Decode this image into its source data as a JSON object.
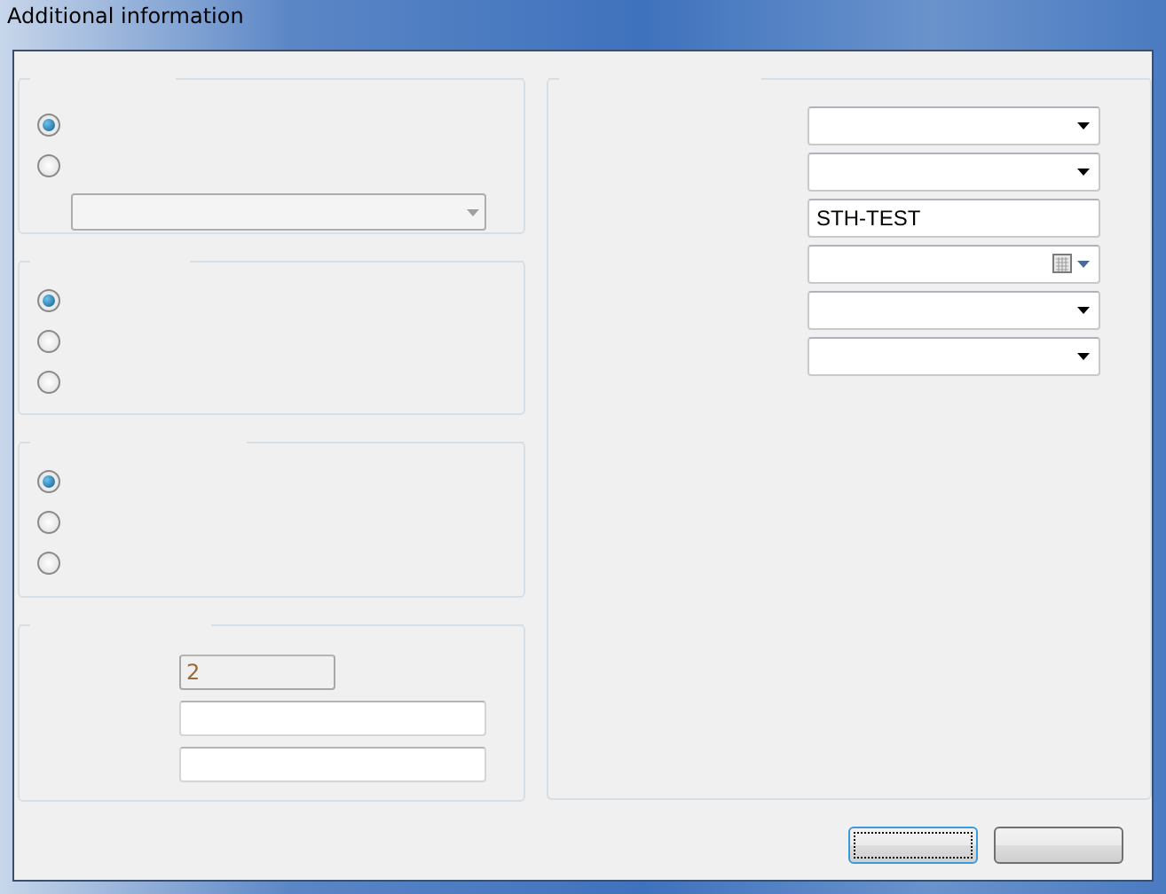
{
  "window": {
    "title": "Additional information"
  },
  "option_groups": [
    {
      "options": [
        {
          "selected": true
        },
        {
          "selected": false
        }
      ],
      "combo": {
        "disabled": true
      }
    },
    {
      "options": [
        {
          "selected": true
        },
        {
          "selected": false
        },
        {
          "selected": false
        }
      ]
    },
    {
      "options": [
        {
          "selected": true
        },
        {
          "selected": false
        },
        {
          "selected": false
        }
      ]
    }
  ],
  "number_group": {
    "fields": [
      {
        "value": "2",
        "disabled": true
      },
      {
        "disabled": false
      },
      {
        "disabled": false
      }
    ]
  },
  "details_fields": [
    {
      "kind": "dropdown"
    },
    {
      "kind": "dropdown"
    },
    {
      "kind": "text",
      "value": "STH-TEST"
    },
    {
      "kind": "date"
    },
    {
      "kind": "dropdown"
    },
    {
      "kind": "dropdown"
    }
  ],
  "buttons": [
    {
      "focused": true
    },
    {
      "focused": false
    }
  ]
}
